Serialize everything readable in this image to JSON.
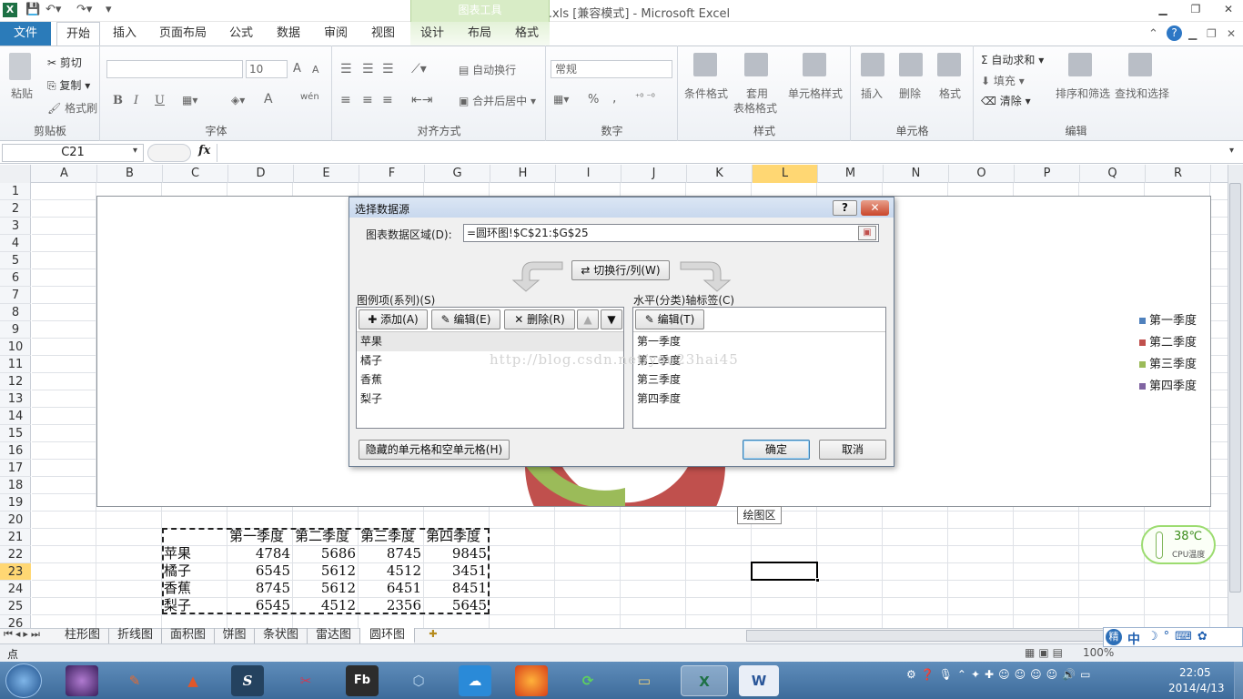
{
  "window": {
    "title": "柱形图.xls  [兼容模式] - Microsoft Excel",
    "context_tab": "图表工具",
    "app_icon": "X"
  },
  "ribbon_tabs": [
    "文件",
    "开始",
    "插入",
    "页面布局",
    "公式",
    "数据",
    "审阅",
    "视图",
    "设计",
    "布局",
    "格式"
  ],
  "ribbon": {
    "clipboard": {
      "paste": "粘贴",
      "cut": "剪切",
      "copy": "复制",
      "format_painter": "格式刷",
      "label": "剪贴板"
    },
    "font": {
      "size": "10",
      "label": "字体",
      "bold": "B",
      "italic": "I",
      "underline": "U",
      "grow": "A",
      "shrink": "A",
      "font_color": "A",
      "phonetic": "wén"
    },
    "alignment": {
      "wrap": "自动换行",
      "merge": "合并后居中",
      "label": "对齐方式"
    },
    "number": {
      "format": "常规",
      "label": "数字",
      "percent": "%",
      "comma": ","
    },
    "styles": {
      "conditional": "条件格式",
      "table_line1": "套用",
      "table_line2": "表格格式",
      "cell_styles": "单元格样式",
      "label": "样式"
    },
    "cells": {
      "insert": "插入",
      "delete": "删除",
      "format": "格式",
      "label": "单元格"
    },
    "editing": {
      "autosum": "自动求和",
      "fill": "填充",
      "clear": "清除",
      "sort": "排序和筛选",
      "find": "查找和选择",
      "label": "编辑"
    }
  },
  "formula_bar": {
    "name_box": "C21",
    "fx": "fx",
    "value": ""
  },
  "columns": [
    "A",
    "B",
    "C",
    "D",
    "E",
    "F",
    "G",
    "H",
    "I",
    "J",
    "K",
    "L",
    "M",
    "N",
    "O",
    "P",
    "Q",
    "R"
  ],
  "rows": [
    "1",
    "2",
    "3",
    "4",
    "5",
    "6",
    "7",
    "8",
    "9",
    "10",
    "11",
    "12",
    "13",
    "14",
    "15",
    "16",
    "17",
    "18",
    "19",
    "20",
    "21",
    "22",
    "23",
    "24",
    "25",
    "26"
  ],
  "chart": {
    "legend": [
      {
        "name": "第一季度",
        "color": "#4f81bd"
      },
      {
        "name": "第二季度",
        "color": "#c0504d"
      },
      {
        "name": "第三季度",
        "color": "#9bbb59"
      },
      {
        "name": "第四季度",
        "color": "#8064a2"
      }
    ],
    "tooltip": "绘图区"
  },
  "table": {
    "headers": [
      "第一季度",
      "第二季度",
      "第三季度",
      "第四季度"
    ],
    "rows": [
      {
        "name": "苹果",
        "values": [
          "4784",
          "5686",
          "8745",
          "9845"
        ]
      },
      {
        "name": "橘子",
        "values": [
          "6545",
          "5612",
          "4512",
          "3451"
        ]
      },
      {
        "name": "香蕉",
        "values": [
          "8745",
          "5612",
          "6451",
          "8451"
        ]
      },
      {
        "name": "梨子",
        "values": [
          "6545",
          "4512",
          "2356",
          "5645"
        ]
      }
    ]
  },
  "dialog": {
    "title": "选择数据源",
    "range_label": "图表数据区域(D):",
    "range_value": "=圆环图!$C$21:$G$25",
    "switch_label": "切换行/列(W)",
    "series_label": "图例项(系列)(S)",
    "add": "添加(A)",
    "edit": "编辑(E)",
    "remove": "删除(R)",
    "series": [
      "苹果",
      "橘子",
      "香蕉",
      "梨子"
    ],
    "axis_label": "水平(分类)轴标签(C)",
    "axis_edit": "编辑(T)",
    "categories": [
      "第一季度",
      "第二季度",
      "第三季度",
      "第四季度"
    ],
    "hidden_cells": "隐藏的单元格和空单元格(H)",
    "ok": "确定",
    "cancel": "取消",
    "help": "?",
    "watermark": "http://blog.csdn.net/you23hai45"
  },
  "sheets": [
    "柱形图",
    "折线图",
    "面积图",
    "饼图",
    "条状图",
    "雷达图",
    "圆环图"
  ],
  "active_sheet": "圆环图",
  "status": {
    "mode": "点",
    "zoom": "100%"
  },
  "cpu_widget": {
    "temp": "38℃",
    "label": "CPU温度"
  },
  "ime": {
    "lang": "中"
  },
  "clock": {
    "time": "22:05",
    "date": "2014/4/13"
  }
}
